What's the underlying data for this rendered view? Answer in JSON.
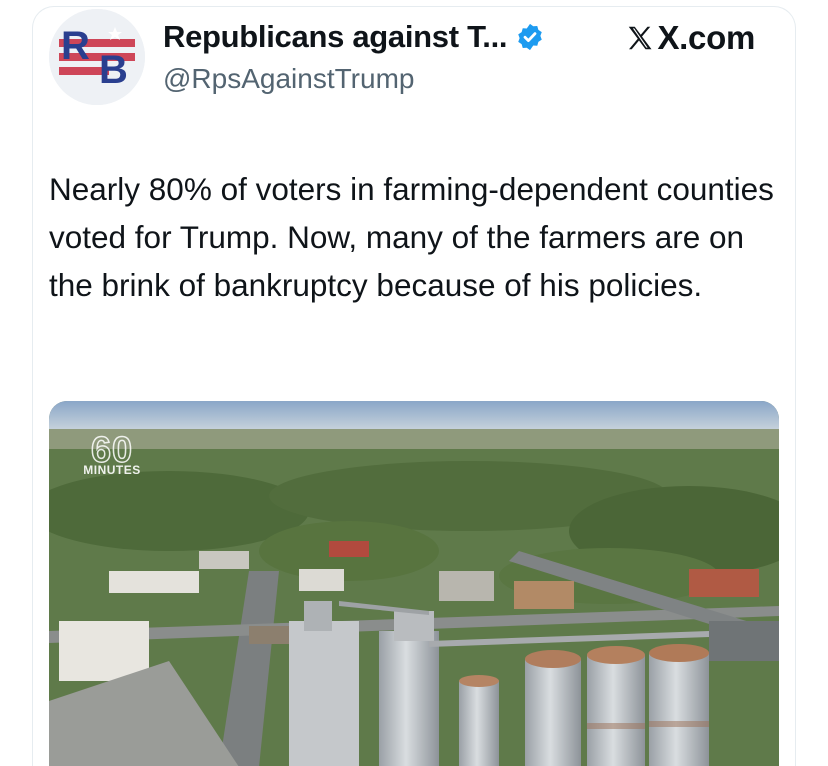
{
  "post": {
    "display_name": "Republicans against T...",
    "handle": "@RpsAgainstTrump",
    "avatar_text": "RB",
    "verified": true,
    "brand": "X.com",
    "text": "Nearly 80% of voters in farming-dependent counties voted for Trump. Now, many of the farmers are on the brink of bankruptcy because of his policies."
  },
  "media": {
    "subject": "aerial view of a rural town with grain silos",
    "logo_number": "60",
    "logo_word": "MINUTES"
  },
  "colors": {
    "text": "#0f1419",
    "secondary_text": "#536471",
    "verified": "#1d9bf0",
    "avatar_red": "#c8283c",
    "avatar_blue": "#2a3f8f"
  },
  "icons": [
    "verified-badge-icon",
    "x-logo-icon"
  ]
}
